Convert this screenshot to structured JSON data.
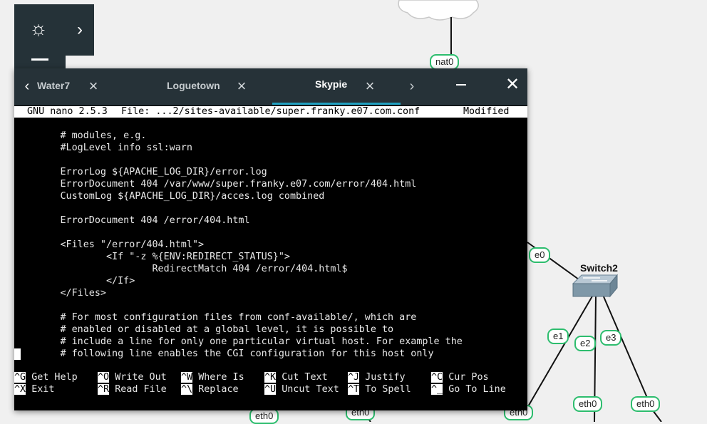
{
  "canvas": {
    "nodes": [
      {
        "label": "nat0"
      },
      {
        "label": "e0"
      },
      {
        "label": "e1"
      },
      {
        "label": "e2"
      },
      {
        "label": "e3"
      },
      {
        "label": "eth0"
      },
      {
        "label": "eth0"
      },
      {
        "label": "eth0"
      },
      {
        "label": "eth0"
      },
      {
        "label": "eth0"
      }
    ],
    "switch_title": "Switch2",
    "trail_text": "",
    "link_color": "#111111",
    "label_border_color": "#2dbd6e"
  },
  "dock": {
    "logo_icon": "chameleon-logo-icon",
    "expand_icon": "chevron-right-icon"
  },
  "terminal": {
    "tabs": [
      {
        "label": "Water7",
        "close": "×"
      },
      {
        "label": "Loguetown",
        "close": "×"
      },
      {
        "label": "Skypie",
        "close": "×"
      }
    ],
    "active_tab": "Skypie",
    "accent_color": "#20a0c0",
    "nav_prev": "‹",
    "nav_next": "›",
    "win_close": "✕"
  },
  "nano": {
    "header_left": "GNU nano 2.5.3",
    "header_file": "File: ...2/sites-available/super.franky.e07.com.conf",
    "header_status": "Modified",
    "lines": [
      "        # modules, e.g.",
      "        #LogLevel info ssl:warn",
      "",
      "        ErrorLog ${APACHE_LOG_DIR}/error.log",
      "        ErrorDocument 404 /var/www/super.franky.e07.com/error/404.html",
      "        CustomLog ${APACHE_LOG_DIR}/acces.log combined",
      "",
      "        ErrorDocument 404 /error/404.html",
      "",
      "        <Files \"/error/404.html\">",
      "                <If \"-z %{ENV:REDIRECT_STATUS}\">",
      "                        RedirectMatch 404 /error/404.html$",
      "                </If>",
      "        </Files>",
      "",
      "        # For most configuration files from conf-available/, which are",
      "        # enabled or disabled at a global level, it is possible to",
      "        # include a line for only one particular virtual host. For example the",
      "        # following line enables the CGI configuration for this host only"
    ],
    "shortcuts_row1": [
      {
        "key": "^G",
        "label": "Get Help"
      },
      {
        "key": "^O",
        "label": "Write Out"
      },
      {
        "key": "^W",
        "label": "Where Is"
      },
      {
        "key": "^K",
        "label": "Cut Text"
      },
      {
        "key": "^J",
        "label": "Justify"
      },
      {
        "key": "^C",
        "label": "Cur Pos"
      }
    ],
    "shortcuts_row2": [
      {
        "key": "^X",
        "label": "Exit"
      },
      {
        "key": "^R",
        "label": "Read File"
      },
      {
        "key": "^\\",
        "label": "Replace"
      },
      {
        "key": "^U",
        "label": "Uncut Text"
      },
      {
        "key": "^T",
        "label": "To Spell"
      },
      {
        "key": "^_",
        "label": "Go To Line"
      }
    ]
  }
}
